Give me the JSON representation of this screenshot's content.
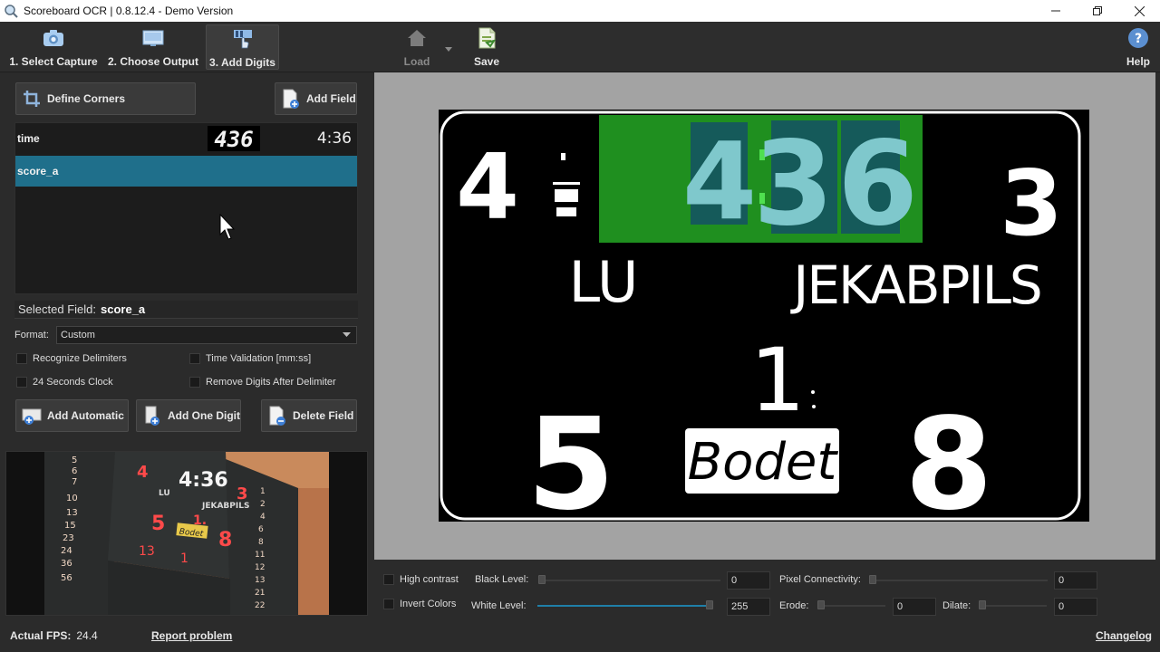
{
  "window": {
    "title": "Scoreboard OCR | 0.8.12.4 - Demo Version",
    "minimize_icon": "minimize-icon",
    "maximize_icon": "restore-icon",
    "close_icon": "close-icon"
  },
  "toolbar": {
    "steps": [
      {
        "label": "1. Select Capture",
        "icon": "camera-icon"
      },
      {
        "label": "2. Choose Output",
        "icon": "monitor-icon"
      },
      {
        "label": "3. Add Digits",
        "icon": "digits-hand-icon"
      }
    ],
    "load_label": "Load",
    "save_label": "Save",
    "help_label": "Help"
  },
  "left": {
    "define_corners_label": "Define Corners",
    "add_field_label": "Add Field",
    "fields": [
      {
        "name": "time",
        "value": "4:36",
        "digits_preview": "436"
      },
      {
        "name": "score_a",
        "value": ""
      }
    ],
    "selected_field_label": "Selected Field:",
    "selected_field_value": "score_a",
    "format_label": "Format:",
    "format_value": "Custom",
    "checkboxes": {
      "recognize_delimiters": "Recognize Delimiters",
      "time_validation": "Time Validation [mm:ss]",
      "seconds_clock": "24 Seconds Clock",
      "remove_digits": "Remove Digits After Delimiter"
    },
    "add_automatic_label": "Add Automatic",
    "add_one_digit_label": "Add One Digit",
    "delete_field_label": "Delete Field"
  },
  "scoreboard": {
    "home_score": "4",
    "away_score": "3",
    "clock_minutes": "4",
    "clock_seconds": "36",
    "home_team": "LU",
    "away_team": "JEKABPILS",
    "period": "1",
    "home_fouls": "5",
    "away_fouls": "8",
    "brand": "Bodet",
    "clock_bg": "#1f8f1f",
    "digit_box_bg": "#155a5a",
    "digit_color": "#7fc8cc"
  },
  "preview": {
    "left_numbers": [
      "5",
      "6",
      "7",
      "10",
      "13",
      "15",
      "23",
      "24",
      "36",
      "56"
    ],
    "home_score": "4",
    "away_score": "3",
    "clock": "4:36",
    "home_team": "LU",
    "away_team": "JEKABPILS",
    "period": "1.",
    "home_fouls": "5",
    "away_fouls": "8",
    "brand": "Bodet",
    "bottom_left": "13",
    "bottom_mid": "1",
    "right_numbers": [
      "1",
      "2",
      "4",
      "6",
      "8",
      "11",
      "12",
      "13",
      "21",
      "22"
    ]
  },
  "controls": {
    "high_contrast": "High contrast",
    "invert_colors": "Invert Colors",
    "black_level_label": "Black Level:",
    "black_level_value": "0",
    "white_level_label": "White Level:",
    "white_level_value": "255",
    "pixel_connectivity_label": "Pixel Connectivity:",
    "pixel_connectivity_value": "0",
    "erode_label": "Erode:",
    "erode_value": "0",
    "dilate_label": "Dilate:",
    "dilate_value": "0",
    "accent": "#1f7fa8"
  },
  "status": {
    "fps_label": "Actual FPS:",
    "fps_value": "24.4",
    "report_problem": "Report problem",
    "changelog": "Changelog"
  }
}
